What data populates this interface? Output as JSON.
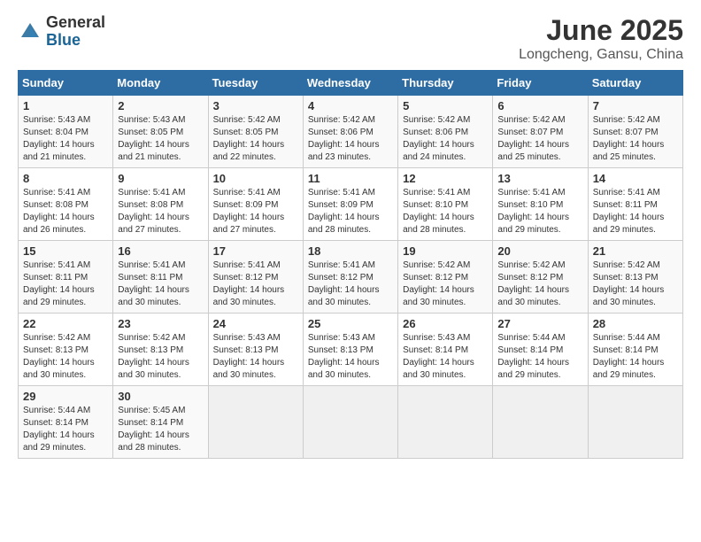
{
  "logo": {
    "general": "General",
    "blue": "Blue"
  },
  "title": "June 2025",
  "subtitle": "Longcheng, Gansu, China",
  "days_of_week": [
    "Sunday",
    "Monday",
    "Tuesday",
    "Wednesday",
    "Thursday",
    "Friday",
    "Saturday"
  ],
  "weeks": [
    [
      {
        "day": "1",
        "sunrise": "5:43 AM",
        "sunset": "8:04 PM",
        "daylight": "14 hours and 21 minutes."
      },
      {
        "day": "2",
        "sunrise": "5:43 AM",
        "sunset": "8:05 PM",
        "daylight": "14 hours and 21 minutes."
      },
      {
        "day": "3",
        "sunrise": "5:42 AM",
        "sunset": "8:05 PM",
        "daylight": "14 hours and 22 minutes."
      },
      {
        "day": "4",
        "sunrise": "5:42 AM",
        "sunset": "8:06 PM",
        "daylight": "14 hours and 23 minutes."
      },
      {
        "day": "5",
        "sunrise": "5:42 AM",
        "sunset": "8:06 PM",
        "daylight": "14 hours and 24 minutes."
      },
      {
        "day": "6",
        "sunrise": "5:42 AM",
        "sunset": "8:07 PM",
        "daylight": "14 hours and 25 minutes."
      },
      {
        "day": "7",
        "sunrise": "5:42 AM",
        "sunset": "8:07 PM",
        "daylight": "14 hours and 25 minutes."
      }
    ],
    [
      {
        "day": "8",
        "sunrise": "5:41 AM",
        "sunset": "8:08 PM",
        "daylight": "14 hours and 26 minutes."
      },
      {
        "day": "9",
        "sunrise": "5:41 AM",
        "sunset": "8:08 PM",
        "daylight": "14 hours and 27 minutes."
      },
      {
        "day": "10",
        "sunrise": "5:41 AM",
        "sunset": "8:09 PM",
        "daylight": "14 hours and 27 minutes."
      },
      {
        "day": "11",
        "sunrise": "5:41 AM",
        "sunset": "8:09 PM",
        "daylight": "14 hours and 28 minutes."
      },
      {
        "day": "12",
        "sunrise": "5:41 AM",
        "sunset": "8:10 PM",
        "daylight": "14 hours and 28 minutes."
      },
      {
        "day": "13",
        "sunrise": "5:41 AM",
        "sunset": "8:10 PM",
        "daylight": "14 hours and 29 minutes."
      },
      {
        "day": "14",
        "sunrise": "5:41 AM",
        "sunset": "8:11 PM",
        "daylight": "14 hours and 29 minutes."
      }
    ],
    [
      {
        "day": "15",
        "sunrise": "5:41 AM",
        "sunset": "8:11 PM",
        "daylight": "14 hours and 29 minutes."
      },
      {
        "day": "16",
        "sunrise": "5:41 AM",
        "sunset": "8:11 PM",
        "daylight": "14 hours and 30 minutes."
      },
      {
        "day": "17",
        "sunrise": "5:41 AM",
        "sunset": "8:12 PM",
        "daylight": "14 hours and 30 minutes."
      },
      {
        "day": "18",
        "sunrise": "5:41 AM",
        "sunset": "8:12 PM",
        "daylight": "14 hours and 30 minutes."
      },
      {
        "day": "19",
        "sunrise": "5:42 AM",
        "sunset": "8:12 PM",
        "daylight": "14 hours and 30 minutes."
      },
      {
        "day": "20",
        "sunrise": "5:42 AM",
        "sunset": "8:12 PM",
        "daylight": "14 hours and 30 minutes."
      },
      {
        "day": "21",
        "sunrise": "5:42 AM",
        "sunset": "8:13 PM",
        "daylight": "14 hours and 30 minutes."
      }
    ],
    [
      {
        "day": "22",
        "sunrise": "5:42 AM",
        "sunset": "8:13 PM",
        "daylight": "14 hours and 30 minutes."
      },
      {
        "day": "23",
        "sunrise": "5:42 AM",
        "sunset": "8:13 PM",
        "daylight": "14 hours and 30 minutes."
      },
      {
        "day": "24",
        "sunrise": "5:43 AM",
        "sunset": "8:13 PM",
        "daylight": "14 hours and 30 minutes."
      },
      {
        "day": "25",
        "sunrise": "5:43 AM",
        "sunset": "8:13 PM",
        "daylight": "14 hours and 30 minutes."
      },
      {
        "day": "26",
        "sunrise": "5:43 AM",
        "sunset": "8:14 PM",
        "daylight": "14 hours and 30 minutes."
      },
      {
        "day": "27",
        "sunrise": "5:44 AM",
        "sunset": "8:14 PM",
        "daylight": "14 hours and 29 minutes."
      },
      {
        "day": "28",
        "sunrise": "5:44 AM",
        "sunset": "8:14 PM",
        "daylight": "14 hours and 29 minutes."
      }
    ],
    [
      {
        "day": "29",
        "sunrise": "5:44 AM",
        "sunset": "8:14 PM",
        "daylight": "14 hours and 29 minutes."
      },
      {
        "day": "30",
        "sunrise": "5:45 AM",
        "sunset": "8:14 PM",
        "daylight": "14 hours and 28 minutes."
      },
      null,
      null,
      null,
      null,
      null
    ]
  ]
}
